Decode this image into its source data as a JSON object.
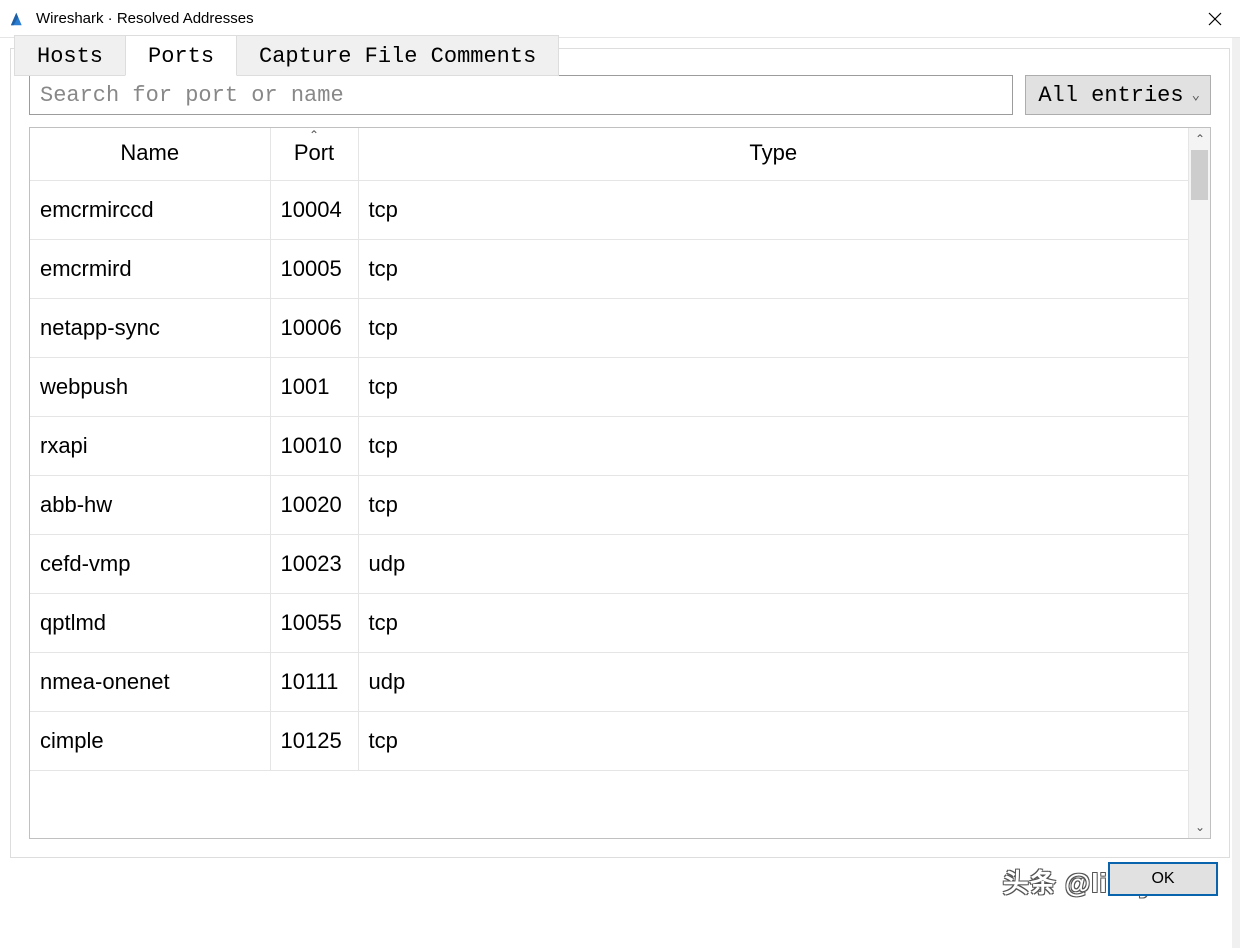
{
  "window": {
    "title": "Wireshark · Resolved Addresses"
  },
  "tabs": [
    {
      "label": "Hosts",
      "active": false
    },
    {
      "label": "Ports",
      "active": true
    },
    {
      "label": "Capture File Comments",
      "active": false
    }
  ],
  "search": {
    "value": "",
    "placeholder": "Search for port or name"
  },
  "filter": {
    "label": "All entries"
  },
  "table": {
    "columns": [
      "Name",
      "Port",
      "Type"
    ],
    "sort_column": 1,
    "rows": [
      {
        "name": "emcrmirccd",
        "port": "10004",
        "type": "tcp"
      },
      {
        "name": "emcrmird",
        "port": "10005",
        "type": "tcp"
      },
      {
        "name": "netapp-sync",
        "port": "10006",
        "type": "tcp"
      },
      {
        "name": "webpush",
        "port": "1001",
        "type": "tcp"
      },
      {
        "name": "rxapi",
        "port": "10010",
        "type": "tcp"
      },
      {
        "name": "abb-hw",
        "port": "10020",
        "type": "tcp"
      },
      {
        "name": "cefd-vmp",
        "port": "10023",
        "type": "udp"
      },
      {
        "name": "qptlmd",
        "port": "10055",
        "type": "tcp"
      },
      {
        "name": "nmea-onenet",
        "port": "10111",
        "type": "udp"
      },
      {
        "name": "cimple",
        "port": "10125",
        "type": "tcp"
      }
    ]
  },
  "buttons": {
    "ok": "OK"
  },
  "watermark": "头条 @likeyuNG"
}
